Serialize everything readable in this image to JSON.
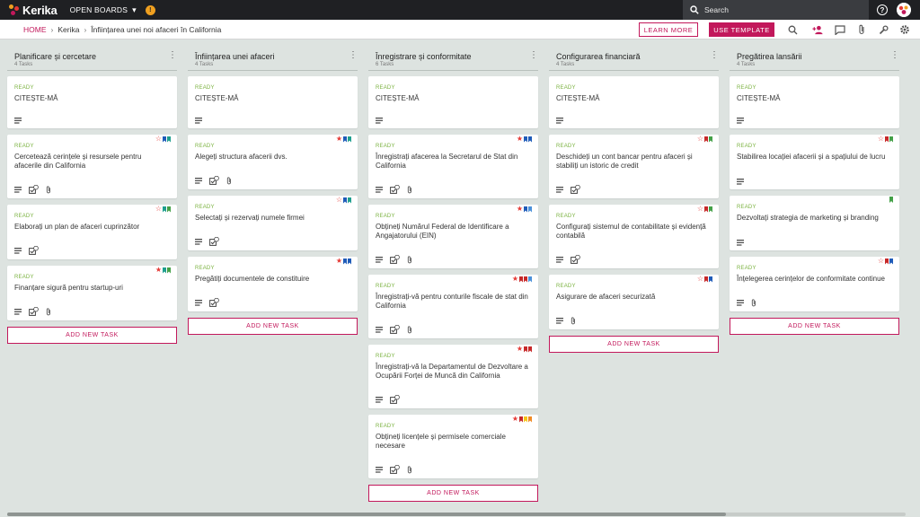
{
  "app": {
    "logo_text": "Kerika",
    "boards_menu": "OPEN BOARDS",
    "notification_icon": "!"
  },
  "search": {
    "placeholder": "Search"
  },
  "breadcrumb": {
    "home": "HOME",
    "org": "Kerika",
    "board": "Înființarea unei noi afaceri în California"
  },
  "actions": {
    "learn_more": "LEARN MORE",
    "use_template": "USE TEMPLATE"
  },
  "colors": {
    "accent": "#c2185b",
    "ready": "#7cb342",
    "star": "#e53935",
    "flag_blue": "#1e5bb8",
    "flag_lightblue": "#4a90d9",
    "flag_teal": "#1e9e8e",
    "flag_green": "#43a047",
    "flag_red": "#c62828",
    "flag_yellow": "#f5c518",
    "flag_orange": "#f08a24"
  },
  "add_task_label": "ADD NEW TASK",
  "columns": [
    {
      "title": "Planificare și cercetare",
      "count": "4 Tasks",
      "cards": [
        {
          "status": "READY",
          "title": "CITEȘTE-MĂ",
          "star": "none",
          "flags": [],
          "icons": [
            "desc"
          ]
        },
        {
          "status": "READY",
          "title": "Cercetează cerințele și resursele pentru afacerile din California",
          "star": "outline",
          "flags": [
            "flag_blue",
            "flag_teal"
          ],
          "icons": [
            "desc",
            "check",
            "attach"
          ]
        },
        {
          "status": "READY",
          "title": "Elaborați un plan de afaceri cuprinzător",
          "star": "outline",
          "flags": [
            "flag_teal",
            "flag_green"
          ],
          "icons": [
            "desc",
            "check"
          ]
        },
        {
          "status": "READY",
          "title": "Finanțare sigură pentru startup-uri",
          "star": "filled",
          "flags": [
            "flag_teal",
            "flag_green"
          ],
          "icons": [
            "desc",
            "check",
            "attach"
          ]
        }
      ]
    },
    {
      "title": "Înființarea unei afaceri",
      "count": "4 Tasks",
      "cards": [
        {
          "status": "READY",
          "title": "CITEȘTE-MĂ",
          "star": "none",
          "flags": [],
          "icons": [
            "desc"
          ]
        },
        {
          "status": "READY",
          "title": "Alegeți structura afacerii dvs.",
          "star": "filled",
          "flags": [
            "flag_blue",
            "flag_teal"
          ],
          "icons": [
            "desc",
            "check",
            "attach"
          ]
        },
        {
          "status": "READY",
          "title": "Selectați și rezervați numele firmei",
          "star": "outline",
          "flags": [
            "flag_blue",
            "flag_teal"
          ],
          "icons": [
            "desc",
            "check"
          ]
        },
        {
          "status": "READY",
          "title": "Pregătiți documentele de constituire",
          "star": "filled",
          "flags": [
            "flag_blue",
            "flag_blue"
          ],
          "icons": [
            "desc",
            "check"
          ]
        }
      ]
    },
    {
      "title": "Înregistrare și conformitate",
      "count": "6 Tasks",
      "cards": [
        {
          "status": "READY",
          "title": "CITEȘTE-MĂ",
          "star": "none",
          "flags": [],
          "icons": [
            "desc"
          ]
        },
        {
          "status": "READY",
          "title": "Înregistrați afacerea la Secretarul de Stat din California",
          "star": "filled",
          "flags": [
            "flag_blue",
            "flag_blue"
          ],
          "icons": [
            "desc",
            "check",
            "attach"
          ]
        },
        {
          "status": "READY",
          "title": "Obțineți Numărul Federal de Identificare a Angajatorului (EIN)",
          "star": "filled",
          "flags": [
            "flag_blue",
            "flag_lightblue"
          ],
          "icons": [
            "desc",
            "check",
            "attach"
          ]
        },
        {
          "status": "READY",
          "title": "Înregistrați-vă pentru conturile fiscale de stat din California",
          "star": "filled",
          "flags": [
            "flag_red",
            "flag_red",
            "flag_lightblue"
          ],
          "icons": [
            "desc",
            "check",
            "attach"
          ]
        },
        {
          "status": "READY",
          "title": "Înregistrați-vă la Departamentul de Dezvoltare a Ocupării Forței de Muncă din California",
          "star": "filled",
          "flags": [
            "flag_red",
            "flag_red"
          ],
          "icons": [
            "desc",
            "check"
          ]
        },
        {
          "status": "READY",
          "title": "Obțineți licențele și permisele comerciale necesare",
          "star": "filled",
          "flags": [
            "flag_red",
            "flag_yellow",
            "flag_orange"
          ],
          "icons": [
            "desc",
            "check",
            "attach"
          ]
        }
      ]
    },
    {
      "title": "Configurarea financiară",
      "count": "4 Tasks",
      "cards": [
        {
          "status": "READY",
          "title": "CITEȘTE-MĂ",
          "star": "none",
          "flags": [],
          "icons": [
            "desc"
          ]
        },
        {
          "status": "READY",
          "title": "Deschideți un cont bancar pentru afaceri și stabiliți un istoric de credit",
          "star": "outline",
          "flags": [
            "flag_red",
            "flag_green"
          ],
          "icons": [
            "desc",
            "check"
          ]
        },
        {
          "status": "READY",
          "title": "Configurați sistemul de contabilitate și evidență contabilă",
          "star": "outline",
          "flags": [
            "flag_red",
            "flag_green"
          ],
          "icons": [
            "desc",
            "check"
          ]
        },
        {
          "status": "READY",
          "title": "Asigurare de afaceri securizată",
          "star": "outline",
          "flags": [
            "flag_red",
            "flag_blue"
          ],
          "icons": [
            "desc",
            "attach"
          ]
        }
      ]
    },
    {
      "title": "Pregătirea lansării",
      "count": "4 Tasks",
      "cards": [
        {
          "status": "READY",
          "title": "CITEȘTE-MĂ",
          "star": "none",
          "flags": [],
          "icons": [
            "desc"
          ]
        },
        {
          "status": "READY",
          "title": "Stabilirea locației afacerii și a spațiului de lucru",
          "star": "outline",
          "flags": [
            "flag_red",
            "flag_green"
          ],
          "icons": [
            "desc"
          ]
        },
        {
          "status": "READY",
          "title": "Dezvoltați strategia de marketing și branding",
          "star": "none",
          "flags": [
            "flag_green"
          ],
          "icons": [
            "desc"
          ]
        },
        {
          "status": "READY",
          "title": "Înțelegerea cerințelor de conformitate continue",
          "star": "outline",
          "flags": [
            "flag_red",
            "flag_blue"
          ],
          "icons": [
            "desc",
            "attach"
          ]
        }
      ]
    }
  ]
}
